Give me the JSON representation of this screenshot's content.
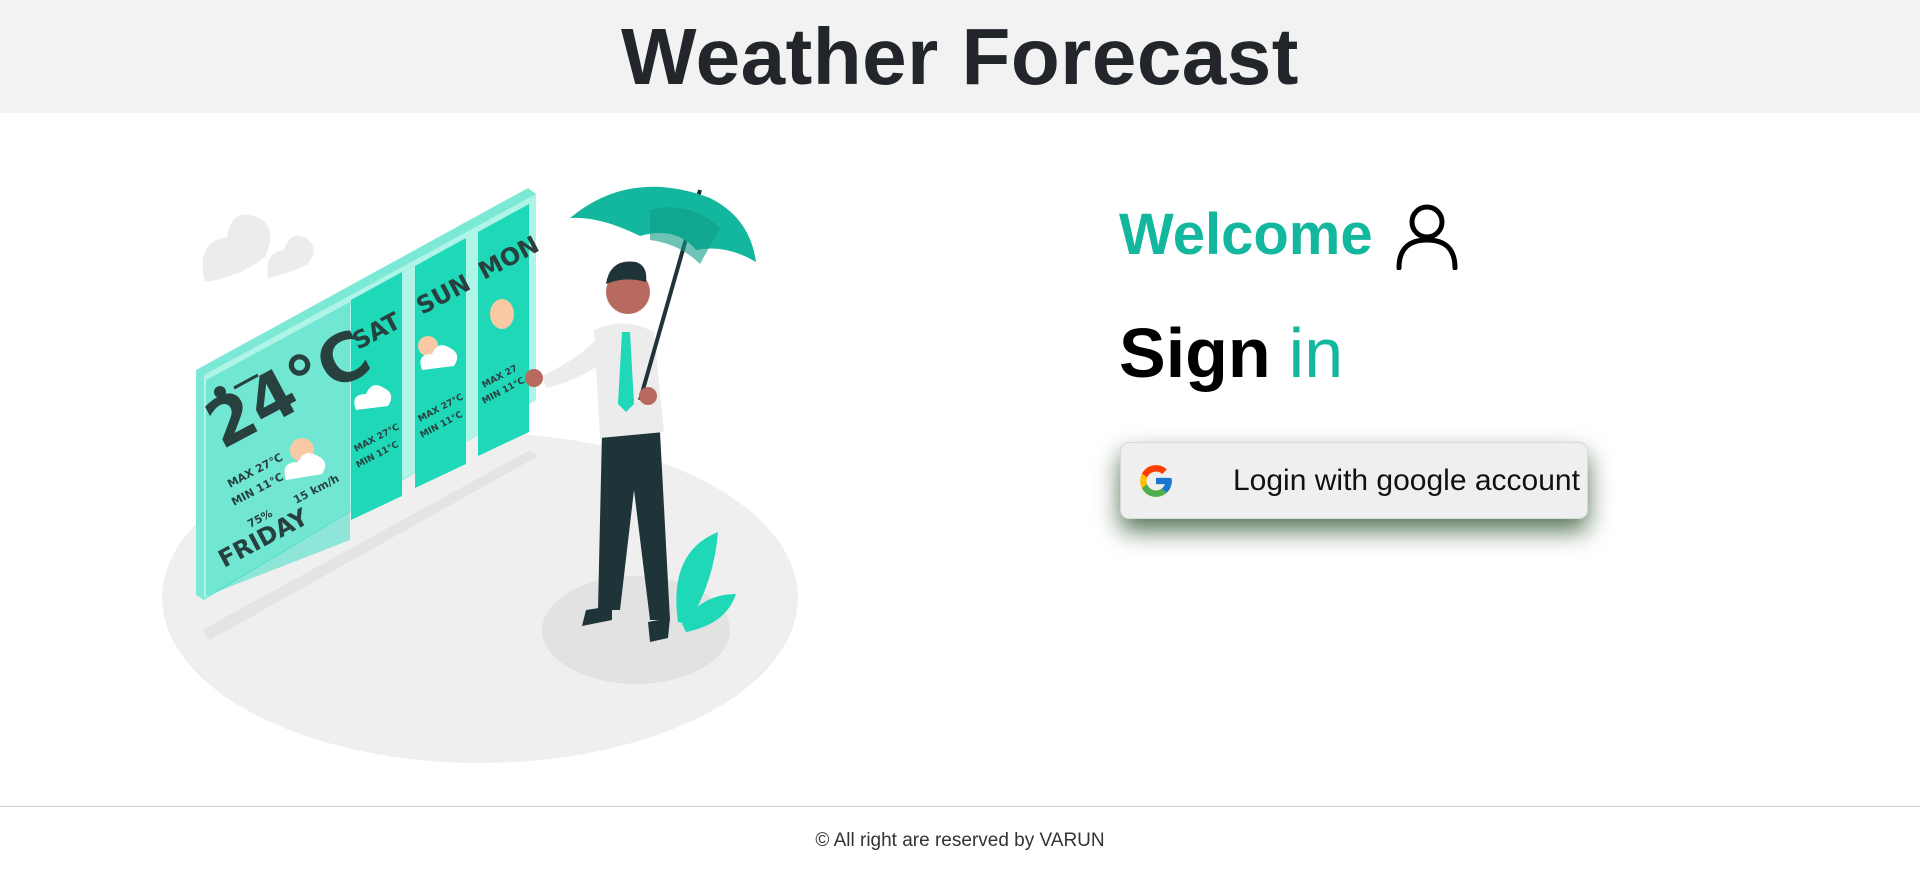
{
  "header": {
    "title": "Weather Forecast"
  },
  "illustration": {
    "temperature": "24°C",
    "day": "FRIDAY",
    "today_max": "MAX 27°C",
    "today_min": "MIN 11°C",
    "humidity": "75%",
    "wind": "15 km/h",
    "cards": [
      {
        "day": "SAT",
        "max": "MAX 27°C",
        "min": "MIN 11°C"
      },
      {
        "day": "SUN",
        "max": "MAX 27°C",
        "min": "MIN 11°C"
      },
      {
        "day": "MON",
        "max": "MAX 27",
        "min": "MIN 11°C"
      }
    ]
  },
  "welcome": {
    "text": "Welcome",
    "icon": "user-icon"
  },
  "signin": {
    "sign": "Sign",
    "in": "in"
  },
  "login": {
    "label": "Login with google account",
    "icon": "google-icon"
  },
  "footer": {
    "text": "© All right are reserved by VARUN"
  },
  "colors": {
    "accent": "#13b79d",
    "header_bg": "#f2f2f2",
    "button_bg": "#efefef"
  }
}
